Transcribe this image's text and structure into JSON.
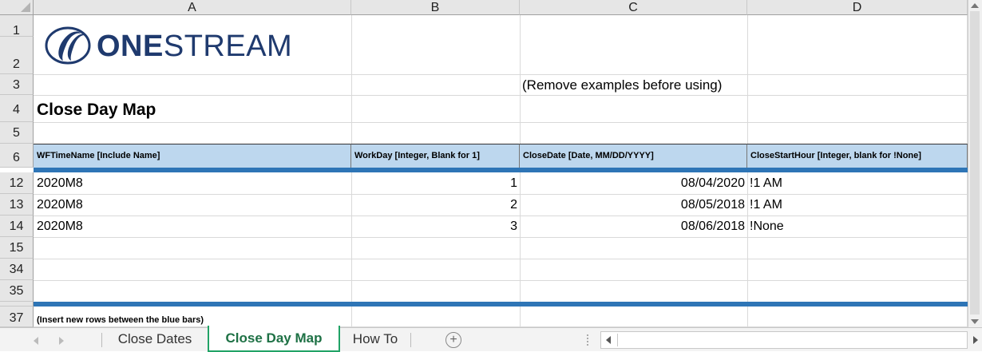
{
  "columns": [
    "A",
    "B",
    "C",
    "D"
  ],
  "row_numbers": [
    "1",
    "2",
    "3",
    "4",
    "5",
    "6",
    "12",
    "13",
    "14",
    "15",
    "34",
    "35",
    "37"
  ],
  "logo": {
    "brand_prefix": "ONE",
    "brand_suffix": "STREAM"
  },
  "note_remove": "(Remove examples before using)",
  "title": "Close Day Map",
  "headers": [
    "WFTimeName [Include Name]",
    "WorkDay [Integer, Blank for 1]",
    "CloseDate [Date, MM/DD/YYYY]",
    "CloseStartHour  [Integer, blank for !None]"
  ],
  "rows": [
    [
      "2020M8",
      "1",
      "08/04/2020",
      "!1 AM"
    ],
    [
      "2020M8",
      "2",
      "08/05/2018",
      "!1 AM"
    ],
    [
      "2020M8",
      "3",
      "08/06/2018",
      "!None"
    ]
  ],
  "footer_note": "(Insert new rows between the blue bars)",
  "sheet_tabs": [
    "Close Dates",
    "Close Day Map",
    "How To"
  ],
  "active_tab": "Close Day Map",
  "add_sheet_symbol": "+",
  "colors": {
    "header_fill": "#bdd7ee",
    "blue_bar": "#2e75b6",
    "active_tab": "#21a366",
    "logo_blue": "#1f3a6e"
  }
}
